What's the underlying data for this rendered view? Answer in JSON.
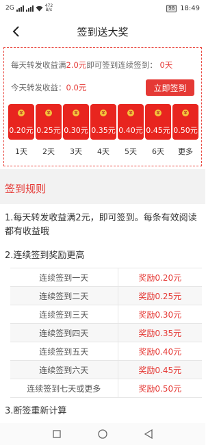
{
  "status_bar": {
    "carrier_left": "2G",
    "speed_value": "472",
    "speed_unit": "B/s",
    "battery": "98",
    "time": "18:49"
  },
  "header": {
    "title": "签到送大奖"
  },
  "signin_panel": {
    "info_prefix": "每天转发收益满",
    "info_amount": "2.0元",
    "info_middle": "即可签到连续签到：",
    "info_days": "0天",
    "today_label": "今天转发收益：",
    "today_value": "0.0元",
    "signin_button": "立即签到",
    "packets": [
      {
        "amount": "0.20元",
        "day": "1天"
      },
      {
        "amount": "0.25元",
        "day": "2天"
      },
      {
        "amount": "0.30元",
        "day": "3天"
      },
      {
        "amount": "0.35元",
        "day": "4天"
      },
      {
        "amount": "0.40元",
        "day": "5天"
      },
      {
        "amount": "0.45元",
        "day": "6天"
      },
      {
        "amount": "0.50元",
        "day": "更多"
      }
    ]
  },
  "rules": {
    "header": "签到规则",
    "rule1": "1.每天转发收益满2元，即可签到。每条有效阅读都有收益哦",
    "rule2": "2.连续签到奖励更高",
    "rule3": "3.断签重新计算",
    "table": [
      {
        "condition": "连续签到一天",
        "reward": "奖励0.20元"
      },
      {
        "condition": "连续签到二天",
        "reward": "奖励0.25元"
      },
      {
        "condition": "连续签到三天",
        "reward": "奖励0.30元"
      },
      {
        "condition": "连续签到四天",
        "reward": "奖励0.35元"
      },
      {
        "condition": "连续签到五天",
        "reward": "奖励0.40元"
      },
      {
        "condition": "连续签到六天",
        "reward": "奖励0.45元"
      },
      {
        "condition": "连续签到七天或更多",
        "reward": "奖励0.50元"
      }
    ]
  },
  "icons": {
    "back": "chevron-left-icon",
    "coin": "yuan-coin-icon",
    "nav_recent": "square-icon",
    "nav_home": "circle-icon",
    "nav_back": "triangle-left-icon"
  },
  "colors": {
    "accent": "#e53935",
    "packet": "#e8251f",
    "coin": "#f5c43b"
  }
}
